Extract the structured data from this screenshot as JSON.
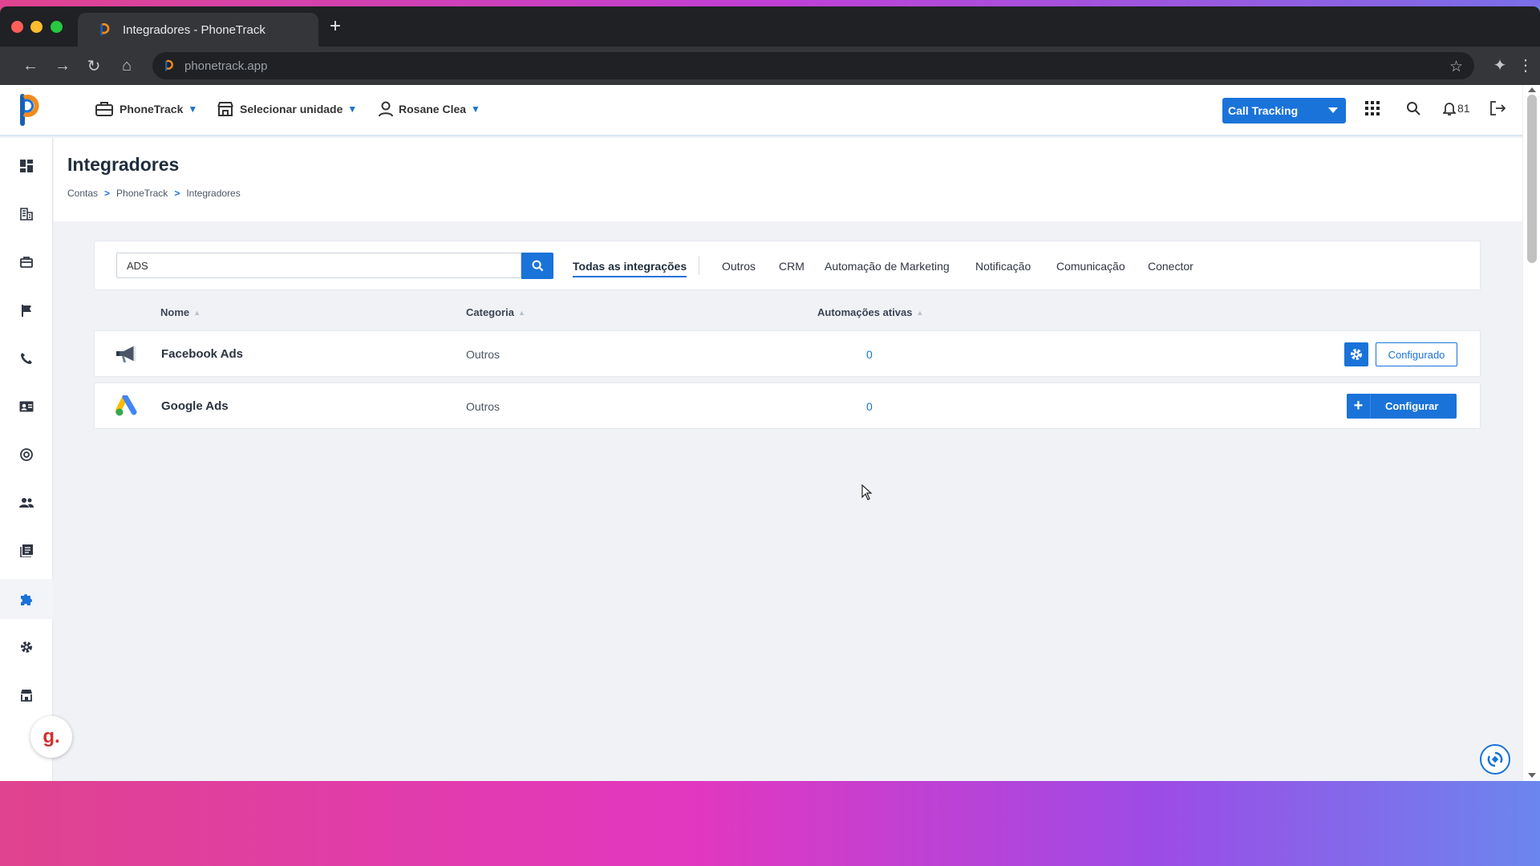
{
  "browser": {
    "tab_title": "Integradores - PhoneTrack",
    "url": "phonetrack.app",
    "new_tab_icon": "plus-icon"
  },
  "header": {
    "account_menu": "PhoneTrack",
    "unit_menu": "Selecionar unidade",
    "user_menu": "Rosane Clea",
    "product_button": "Call Tracking",
    "notifications_count": "81"
  },
  "sidebar": {
    "items": [
      {
        "icon": "dashboard-icon"
      },
      {
        "icon": "building-icon"
      },
      {
        "icon": "briefcase-icon"
      },
      {
        "icon": "flag-icon"
      },
      {
        "icon": "phone-icon"
      },
      {
        "icon": "contact-card-icon"
      },
      {
        "icon": "target-icon"
      },
      {
        "icon": "users-icon"
      },
      {
        "icon": "library-icon"
      },
      {
        "icon": "puzzle-icon",
        "active": true
      },
      {
        "icon": "gear-icon"
      },
      {
        "icon": "store-icon"
      }
    ]
  },
  "page": {
    "title": "Integradores",
    "breadcrumb": [
      "Contas",
      "PhoneTrack",
      "Integradores"
    ]
  },
  "filters": {
    "search_value": "ADS",
    "tabs": [
      "Todas as integrações",
      "Outros",
      "CRM",
      "Automação de Marketing",
      "Notificação",
      "Comunicação",
      "Conector"
    ],
    "active_tab": "Todas as integrações"
  },
  "table": {
    "columns": [
      "Nome",
      "Categoria",
      "Automações ativas"
    ],
    "rows": [
      {
        "name": "Facebook Ads",
        "category": "Outros",
        "active_automations": "0",
        "icon": "megaphone-icon",
        "action": "Configurado",
        "status": "configured"
      },
      {
        "name": "Google Ads",
        "category": "Outros",
        "active_automations": "0",
        "icon": "google-ads-icon",
        "action": "Configurar",
        "status": "not-configured"
      }
    ]
  },
  "widgets": {
    "g_badge": "g."
  },
  "colors": {
    "accent": "#1a73d9",
    "page_bg": "#f0f2f6"
  }
}
